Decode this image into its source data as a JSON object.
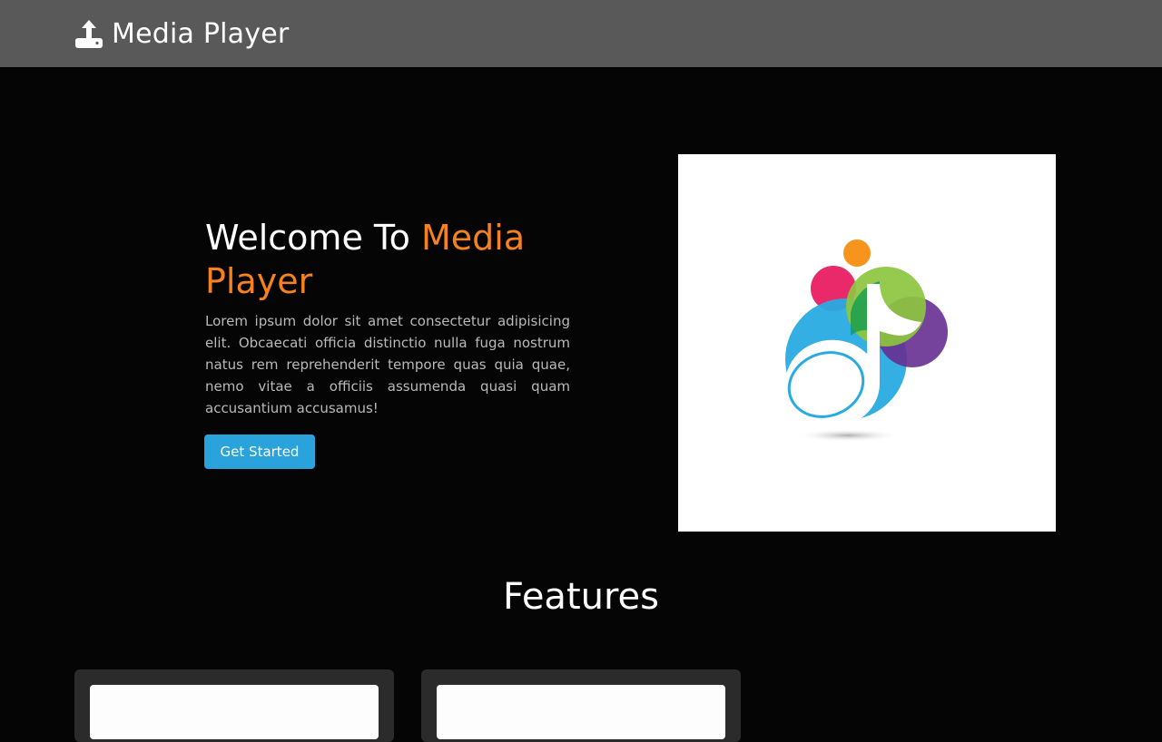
{
  "navbar": {
    "brand_icon": "upload-icon",
    "brand_text": "Media Player"
  },
  "hero": {
    "title_prefix": "Welcome To ",
    "title_accent": "Media Player",
    "description": "Lorem ipsum dolor sit amet consectetur adipisicing elit. Obcaecati officia distinctio nulla fuga nostrum natus rem reprehenderit tempore quas quia quae, nemo vitae a officiis assumenda quasi quam accusantium accusamus!",
    "cta_label": "Get Started",
    "image_icon": "music-note-logo"
  },
  "features": {
    "heading": "Features",
    "cards": [
      {
        "icon": "feature-card-image"
      },
      {
        "icon": "feature-card-image"
      }
    ]
  },
  "colors": {
    "background": "#050505",
    "navbar": "#595959",
    "accent": "#f5821f",
    "button": "#2aa3dc",
    "card": "#2b2b2b"
  }
}
